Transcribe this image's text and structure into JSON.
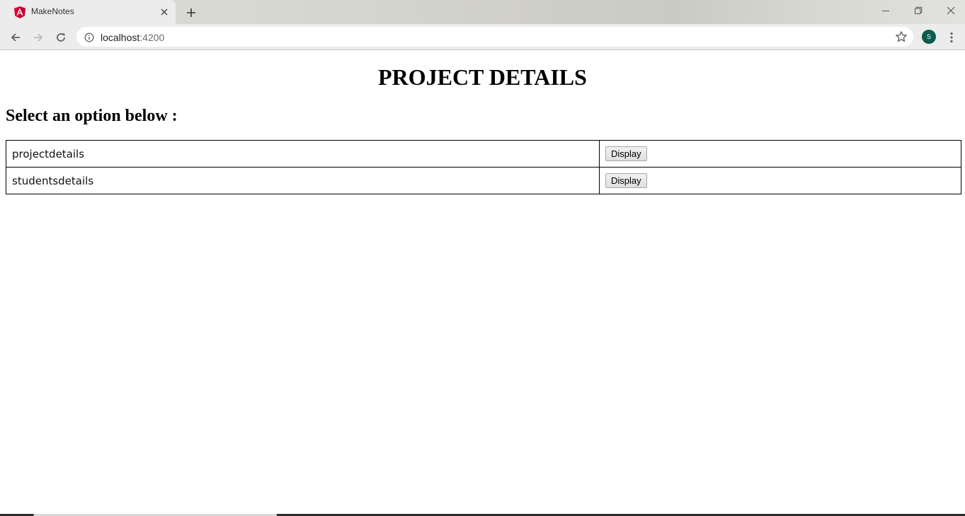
{
  "browser": {
    "tab_title": "MakeNotes",
    "url_host": "localhost",
    "url_port": ":4200",
    "profile_initial": "S",
    "accent_color": "#0d5a4e"
  },
  "page": {
    "title": "PROJECT DETAILS",
    "subheading": "Select an option below :",
    "options": [
      {
        "name": "projectdetails",
        "button_label": "Display"
      },
      {
        "name": "studentsdetails",
        "button_label": "Display"
      }
    ]
  },
  "icons": {
    "favicon": "angular-logo-icon",
    "tab_close": "close-icon",
    "new_tab": "plus-icon",
    "back": "arrow-left-icon",
    "forward": "arrow-right-icon",
    "reload": "reload-icon",
    "site_info": "info-icon",
    "bookmark": "star-icon",
    "menu": "kebab-menu-icon",
    "minimize": "minimize-icon",
    "restore": "restore-icon",
    "window_close": "close-icon"
  }
}
